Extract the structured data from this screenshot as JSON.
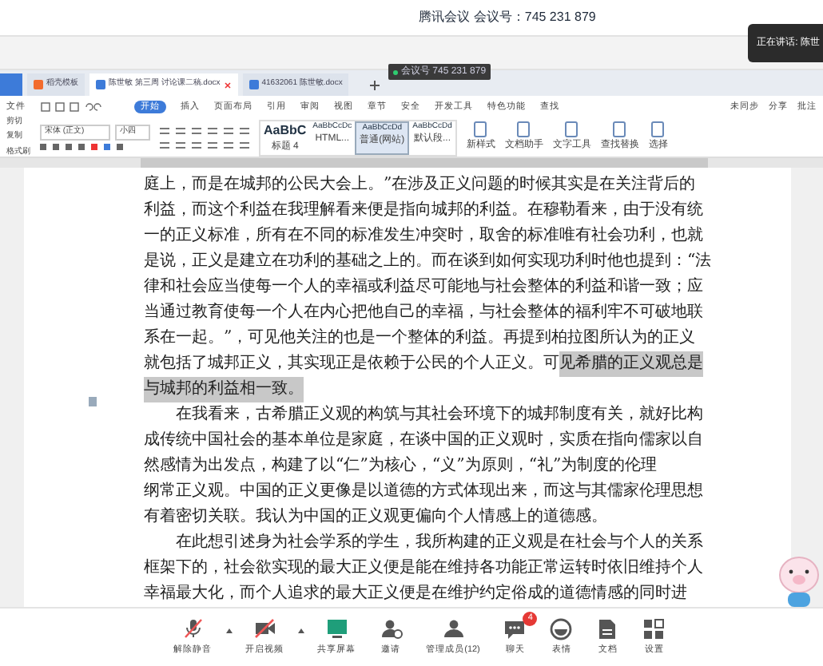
{
  "meeting": {
    "title": "腾讯会议 会议号：745 231 879",
    "speaking": "正在讲话: 陈世",
    "meeting_id_badge": "会议号 745 231 879"
  },
  "wps": {
    "tabs": [
      {
        "label": "稻壳模板",
        "kind": "template",
        "selected": false
      },
      {
        "label": "陈世敏 第三周 讨论课二稿.docx",
        "kind": "doc",
        "selected": true
      },
      {
        "label": "41632061 陈世敏.docx",
        "kind": "doc",
        "selected": false
      }
    ],
    "menu": [
      {
        "label": "文件",
        "selected": false
      },
      {
        "label": "开始",
        "selected": true
      },
      {
        "label": "插入",
        "selected": false
      },
      {
        "label": "页面布局",
        "selected": false
      },
      {
        "label": "引用",
        "selected": false
      },
      {
        "label": "审阅",
        "selected": false
      },
      {
        "label": "视图",
        "selected": false
      },
      {
        "label": "章节",
        "selected": false
      },
      {
        "label": "安全",
        "selected": false
      },
      {
        "label": "开发工具",
        "selected": false
      },
      {
        "label": "特色功能",
        "selected": false
      },
      {
        "label": "查找",
        "selected": false
      }
    ],
    "menu_right": [
      "未同步",
      "分享",
      "批注"
    ],
    "clipboard": [
      "剪切",
      "复制",
      "格式刷"
    ],
    "font": "宋体 (正文)",
    "size": "小四",
    "styles": [
      {
        "sample": "AaBbC",
        "name": "标题 4",
        "selected": false
      },
      {
        "sample": "AaBbCcDc",
        "name": "HTML...",
        "selected": false
      },
      {
        "sample": "AaBbCcDd",
        "name": "普通(网站)",
        "selected": true
      },
      {
        "sample": "AaBbCcDd",
        "name": "默认段...",
        "selected": false
      }
    ],
    "tools": [
      "新样式",
      "文档助手",
      "文字工具",
      "查找替换",
      "选择"
    ]
  },
  "document": {
    "paragraphs": [
      {
        "lines": [
          [
            {
              "text": "庭上，而是在城邦的公民大会上。”在涉及正义问题的时候其实是在关注背后的",
              "highlighted": false
            }
          ],
          [
            {
              "text": "利益，而这个利益在我理解看来便是指向城邦的利益。在穆勒看来，由于没有统",
              "highlighted": false
            }
          ],
          [
            {
              "text": "一的正义标准，所有在不同的标准发生冲突时，取舍的标准唯有社会功利，也就",
              "highlighted": false
            }
          ],
          [
            {
              "text": "是说，正义是建立在功利的基础之上的。而在谈到如何实现功利时他也提到：“法",
              "highlighted": false
            }
          ],
          [
            {
              "text": "律和社会应当使每一个人的幸福或利益尽可能地与社会整体的利益和谐一致；应",
              "highlighted": false
            }
          ],
          [
            {
              "text": "当通过教育使每一个人在内心把他自己的幸福，与社会整体的福利牢不可破地联",
              "highlighted": false
            }
          ],
          [
            {
              "text": "系在一起。”，可见他关注的也是一个整体的利益。再提到柏拉图所认为的正义",
              "highlighted": false
            }
          ],
          [
            {
              "text": "就包括了城邦正义，其实现正是依赖于公民的个人正义。可",
              "highlighted": false
            },
            {
              "text": "见希腊的正义观总是",
              "highlighted": true
            }
          ],
          [
            {
              "text": "与城邦的利益相一致。",
              "highlighted": true
            }
          ]
        ]
      },
      {
        "lines": [
          [
            {
              "text": "　　在我看来，古希腊正义观的构筑与其社会环境下的城邦制度有关，就好比构",
              "highlighted": false
            }
          ],
          [
            {
              "text": "成传统中国社会的基本单位是家庭，在谈中国的正义观时，实质在指向儒家以自",
              "highlighted": false
            }
          ],
          [
            {
              "text": "然感情为出发点，构建了以“仁”为核心，“义”为原则，“礼”为制度的伦理",
              "highlighted": false
            }
          ],
          [
            {
              "text": "纲常正义观。中国的正义更像是以道德的方式体现出来，而这与其儒家伦理思想",
              "highlighted": false
            }
          ],
          [
            {
              "text": "有着密切关联。我认为中国的正义观更偏向个人情感上的道德感。",
              "highlighted": false
            }
          ]
        ]
      },
      {
        "lines": [
          [
            {
              "text": "　　在此想引述身为社会学系的学生，我所构建的正义观是在社会与个人的关系",
              "highlighted": false
            }
          ],
          [
            {
              "text": "框架下的，社会欲实现的最大正义便是能在维持各功能正常运转时依旧维持个人",
              "highlighted": false
            }
          ],
          [
            {
              "text": "幸福最大化，而个人追求的最大正义便是在维护约定俗成的道德情感的同时进",
              "highlighted": false
            }
          ]
        ]
      }
    ]
  },
  "toolbar": [
    {
      "kind": "mic",
      "label": "解除静音",
      "off": true,
      "caret": true
    },
    {
      "kind": "video",
      "label": "开启视频",
      "off": true,
      "caret": true
    },
    {
      "kind": "share",
      "label": "共享屏幕"
    },
    {
      "kind": "invite",
      "label": "邀请"
    },
    {
      "kind": "members",
      "label": "管理成员(12)"
    },
    {
      "kind": "chat",
      "label": "聊天",
      "badge": "4"
    },
    {
      "kind": "emoji",
      "label": "表情"
    },
    {
      "kind": "doc",
      "label": "文档"
    },
    {
      "kind": "settings",
      "label": "设置"
    }
  ]
}
